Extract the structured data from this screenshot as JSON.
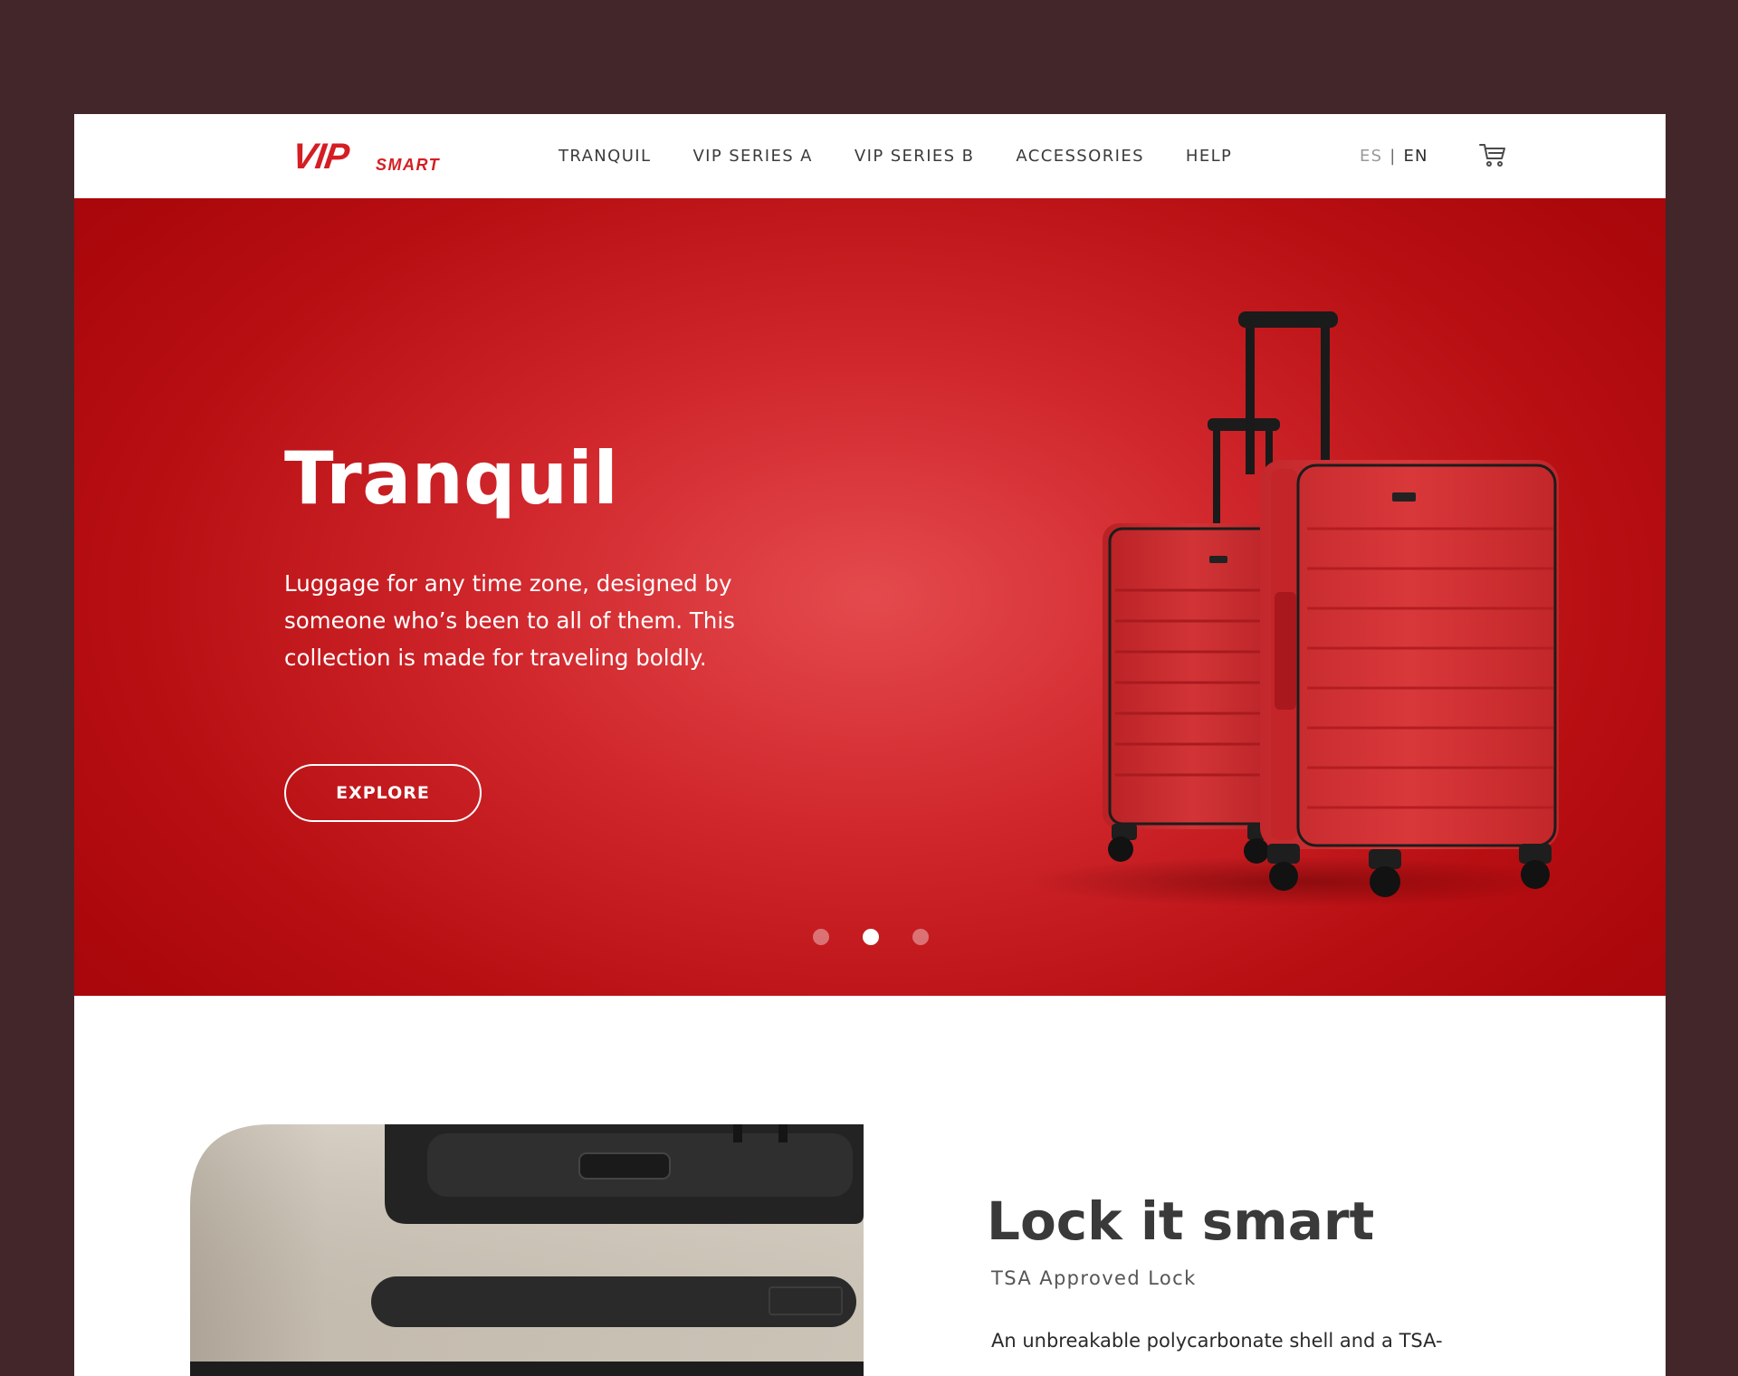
{
  "brand": {
    "logo_mark": "VIP",
    "logo_sub": "SMART",
    "accent_color": "#d41e23"
  },
  "nav": {
    "items": [
      {
        "label": "TRANQUIL"
      },
      {
        "label": "VIP SERIES A"
      },
      {
        "label": "VIP SERIES B"
      },
      {
        "label": "ACCESSORIES"
      },
      {
        "label": "HELP"
      }
    ]
  },
  "language": {
    "es": "ES",
    "separator": "|",
    "en": "EN",
    "selected": "EN"
  },
  "cart": {
    "icon": "cart-icon"
  },
  "hero": {
    "title": "Tranquil",
    "description": "Luggage for any time zone, designed by someone who’s been to all of them. This collection is made for traveling boldly.",
    "cta_label": "EXPLORE",
    "background_color": "#c51a1f",
    "slides_count": 3,
    "active_slide": 2
  },
  "feature": {
    "title": "Lock it smart",
    "subtitle": "TSA Approved Lock",
    "description": "An unbreakable polycarbonate shell and a TSA-"
  },
  "page": {
    "outer_background": "#43262a"
  }
}
